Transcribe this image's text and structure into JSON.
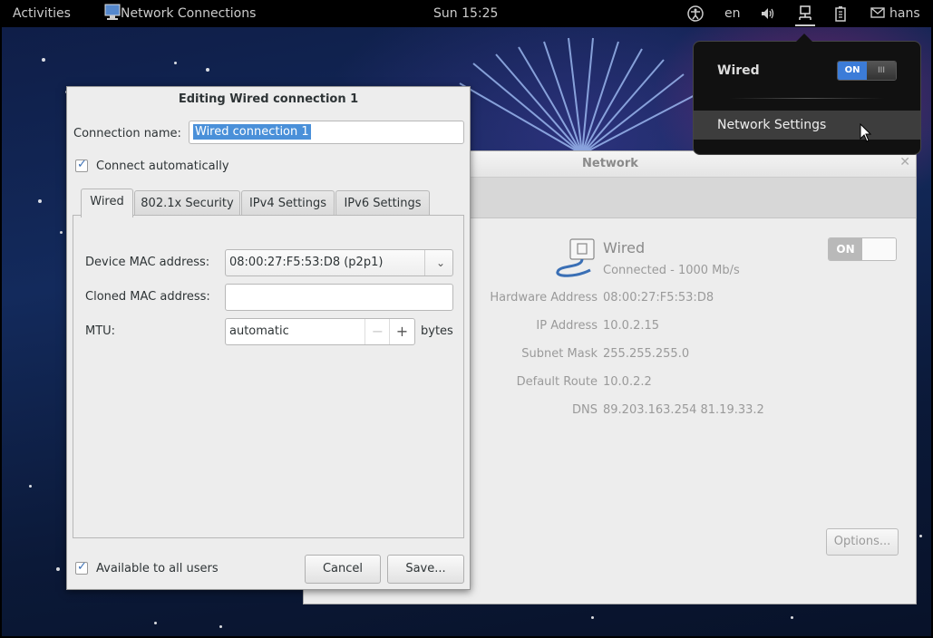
{
  "topbar": {
    "activities": "Activities",
    "app_title": "Network Connections",
    "clock": "Sun 15:25",
    "language": "en",
    "user": "hans",
    "icons": [
      "accessibility-icon",
      "volume-icon",
      "network-icon",
      "battery-icon",
      "user-status-icon"
    ]
  },
  "network_menu": {
    "wired_label": "Wired",
    "switch_on": "ON",
    "network_settings": "Network Settings"
  },
  "network_window": {
    "title": "Network",
    "wired_title": "Wired",
    "wired_status": "Connected - 1000 Mb/s",
    "switch_on": "ON",
    "rows": [
      {
        "label": "Hardware Address",
        "value": "08:00:27:F5:53:D8"
      },
      {
        "label": "IP Address",
        "value": "10.0.2.15"
      },
      {
        "label": "Subnet Mask",
        "value": "255.255.255.0"
      },
      {
        "label": "Default Route",
        "value": "10.0.2.2"
      },
      {
        "label": "DNS",
        "value": "89.203.163.254 81.19.33.2"
      }
    ],
    "options": "Options..."
  },
  "dialog": {
    "title": "Editing Wired connection 1",
    "connection_name_label": "Connection name:",
    "connection_name_value": "Wired connection 1",
    "connect_auto": "Connect automatically",
    "tabs": [
      "Wired",
      "802.1x Security",
      "IPv4 Settings",
      "IPv6 Settings"
    ],
    "device_mac_label": "Device MAC address:",
    "device_mac_value": "08:00:27:F5:53:D8 (p2p1)",
    "cloned_mac_label": "Cloned MAC address:",
    "cloned_mac_value": "",
    "mtu_label": "MTU:",
    "mtu_value": "automatic",
    "mtu_unit": "bytes",
    "available_all": "Available to all users",
    "cancel": "Cancel",
    "save": "Save..."
  },
  "colors": {
    "accent": "#3c7cd8",
    "selection": "#4a90d9",
    "topbar": "#000000"
  }
}
